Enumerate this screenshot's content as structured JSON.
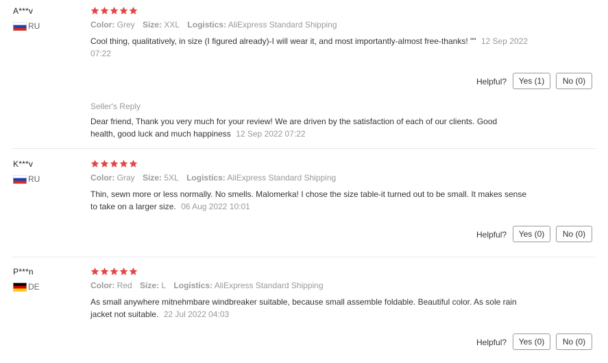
{
  "labels": {
    "color": "Color:",
    "size": "Size:",
    "logistics": "Logistics:",
    "helpful": "Helpful?",
    "seller_reply": "Seller's Reply"
  },
  "colors": {
    "star": "#e64545",
    "flag_ru": [
      "#ffffff",
      "#1c3fb3",
      "#d52b1e"
    ],
    "flag_de": [
      "#000000",
      "#dd0000",
      "#ffce00"
    ]
  },
  "reviews": [
    {
      "user": "A***v",
      "country": "RU",
      "rating": 5,
      "color": "Grey",
      "size": "XXL",
      "logistics": "AliExpress Standard Shipping",
      "text": "Cool thing, qualitatively, in size (I figured already)-I will wear it, and most importantly-almost free-thanks! \"\"",
      "time": "12 Sep 2022 07:22",
      "yes": "Yes (1)",
      "no": "No (0)",
      "seller_reply": {
        "text": "Dear friend, Thank you very much for your review! We are driven by the satisfaction of each of our clients. Good health, good luck and much happiness",
        "time": "12 Sep 2022 07:22"
      }
    },
    {
      "user": "K***v",
      "country": "RU",
      "rating": 5,
      "color": "Gray",
      "size": "5XL",
      "logistics": "AliExpress Standard Shipping",
      "text": "Thin, sewn more or less normally. No smells. Malomerka! I chose the size table-it turned out to be small. It makes sense to take on a larger size.",
      "time": "06 Aug 2022 10:01",
      "yes": "Yes (0)",
      "no": "No (0)"
    },
    {
      "user": "P***n",
      "country": "DE",
      "rating": 5,
      "color": "Red",
      "size": "L",
      "logistics": "AliExpress Standard Shipping",
      "text": "As small anywhere mitnehmbare windbreaker suitable, because small assemble foldable. Beautiful color. As sole rain jacket not suitable.",
      "time": "22 Jul 2022 04:03",
      "yes": "Yes (0)",
      "no": "No (0)"
    }
  ]
}
